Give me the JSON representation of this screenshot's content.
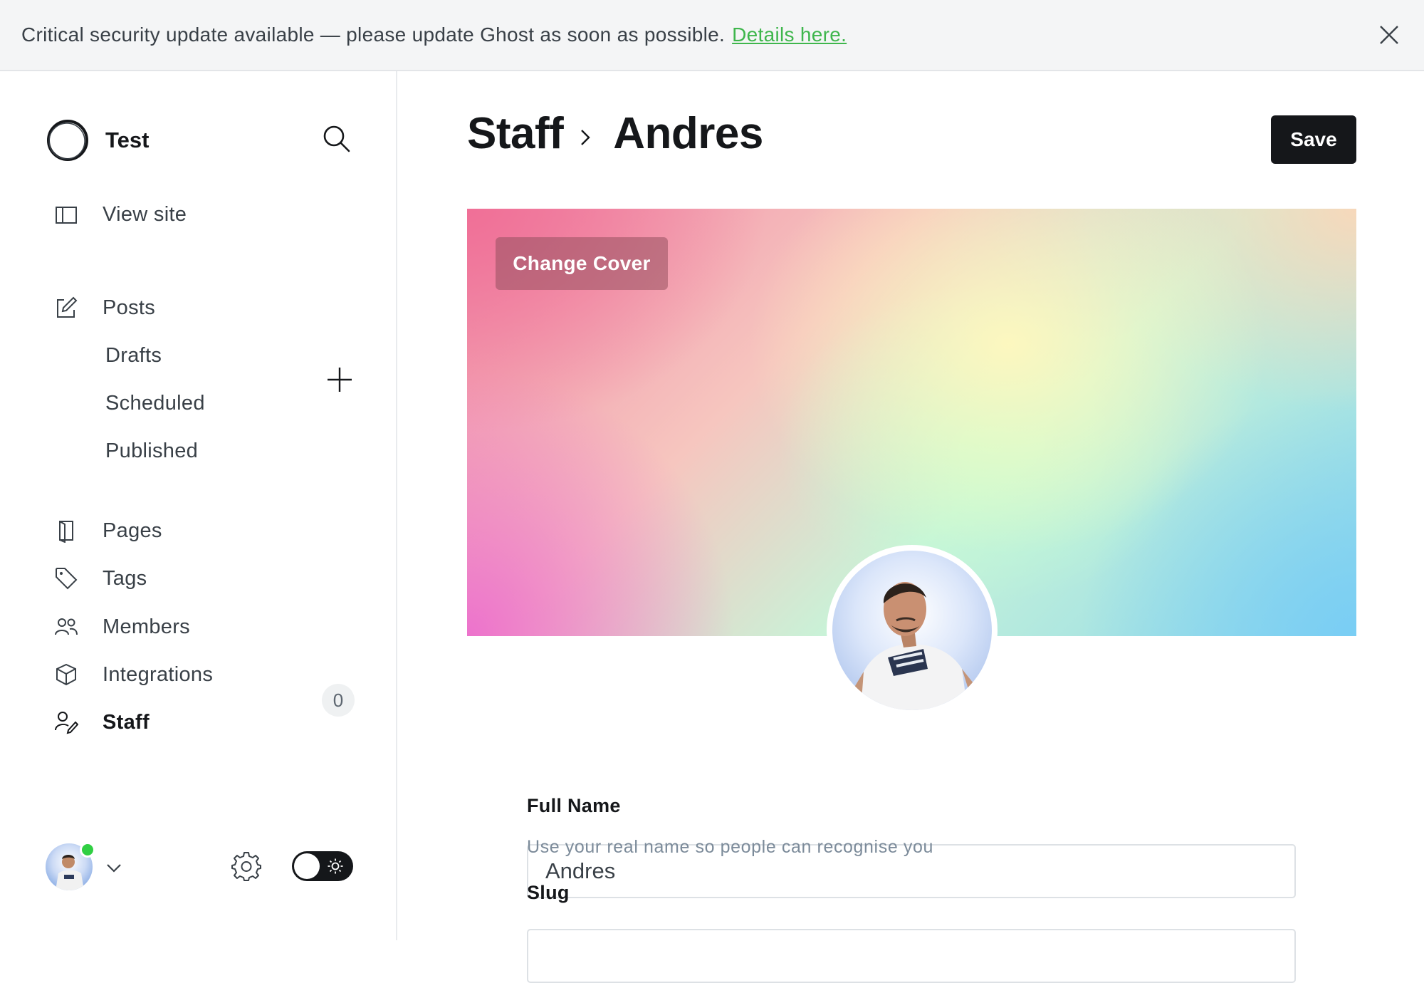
{
  "banner": {
    "message": "Critical security update available — please update Ghost as soon as possible.",
    "link_text": "Details here."
  },
  "sidebar": {
    "site_name": "Test",
    "view_site": "View site",
    "posts": "Posts",
    "sub_items": [
      "Drafts",
      "Scheduled",
      "Published"
    ],
    "pages": "Pages",
    "tags": "Tags",
    "members": "Members",
    "members_count": "0",
    "integrations": "Integrations",
    "staff": "Staff"
  },
  "header": {
    "section": "Staff",
    "name": "Andres",
    "save_label": "Save"
  },
  "cover": {
    "change_label": "Change Cover"
  },
  "form": {
    "full_name_label": "Full Name",
    "full_name_value": "Andres",
    "full_name_hint": "Use your real name so people can recognise you",
    "slug_label": "Slug"
  },
  "colors": {
    "accent_green": "#30cf43",
    "primary_dark": "#15171a"
  },
  "icons": [
    "close-icon",
    "search-icon",
    "view-site-icon",
    "posts-icon",
    "plus-icon",
    "pages-icon",
    "tags-icon",
    "members-icon",
    "integrations-icon",
    "staff-icon",
    "chevron-down-icon",
    "gear-icon",
    "sun-icon",
    "chevron-right-icon"
  ]
}
